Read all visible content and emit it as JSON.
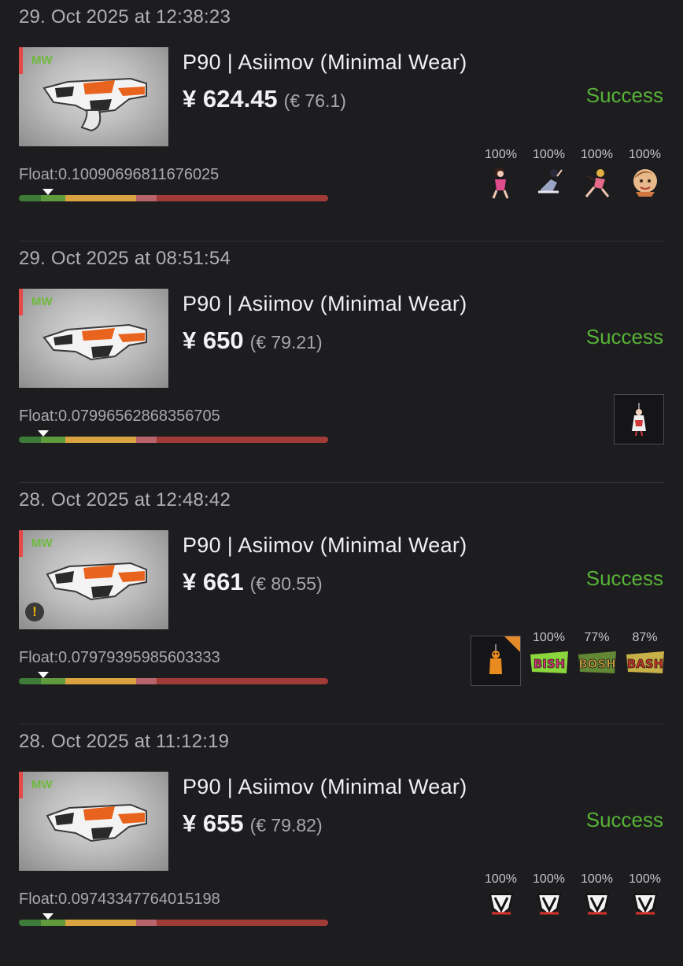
{
  "status_color": "#57b237",
  "entries": [
    {
      "date": "29. Oct 2025 at 12:38:23",
      "wear": "MW",
      "title": "P90 | Asiimov (Minimal Wear)",
      "price": "¥ 624.45",
      "price_eur": "(€ 76.1)",
      "status": "Success",
      "float": "Float:0.10090696811676025",
      "stickers": [
        {
          "pct": "100%",
          "icon": "pinup-girl-sticker-icon"
        },
        {
          "pct": "100%",
          "icon": "pinup-girl-sticker-icon"
        },
        {
          "pct": "100%",
          "icon": "pinup-girl-sticker-icon"
        },
        {
          "pct": "100%",
          "icon": "pinup-girl-sticker-icon"
        }
      ]
    },
    {
      "date": "29. Oct 2025 at 08:51:54",
      "wear": "MW",
      "title": "P90 | Asiimov (Minimal Wear)",
      "price": "¥ 650",
      "price_eur": "(€ 79.21)",
      "status": "Success",
      "float": "Float:0.07996562868356705",
      "charm": "girl-charm-icon"
    },
    {
      "date": "28. Oct 2025 at 12:48:42",
      "wear": "MW",
      "title": "P90 | Asiimov (Minimal Wear)",
      "price": "¥ 661",
      "price_eur": "(€ 80.55)",
      "status": "Success",
      "float": "Float:0.07979395985603333",
      "warning": "!",
      "charm": "orange-figure-charm-icon",
      "stickers": [
        {
          "pct": "100%",
          "icon": "graffiti-sticker-icon"
        },
        {
          "pct": "77%",
          "icon": "graffiti-sticker-icon"
        },
        {
          "pct": "87%",
          "icon": "graffiti-sticker-icon"
        }
      ]
    },
    {
      "date": "28. Oct 2025 at 11:12:19",
      "wear": "MW",
      "title": "P90 | Asiimov (Minimal Wear)",
      "price": "¥ 655",
      "price_eur": "(€ 79.82)",
      "status": "Success",
      "float": "Float:0.09743347764015198",
      "stickers": [
        {
          "pct": "100%",
          "icon": "virtus-pro-sticker-icon"
        },
        {
          "pct": "100%",
          "icon": "virtus-pro-sticker-icon"
        },
        {
          "pct": "100%",
          "icon": "virtus-pro-sticker-icon"
        },
        {
          "pct": "100%",
          "icon": "virtus-pro-sticker-icon"
        }
      ]
    }
  ]
}
